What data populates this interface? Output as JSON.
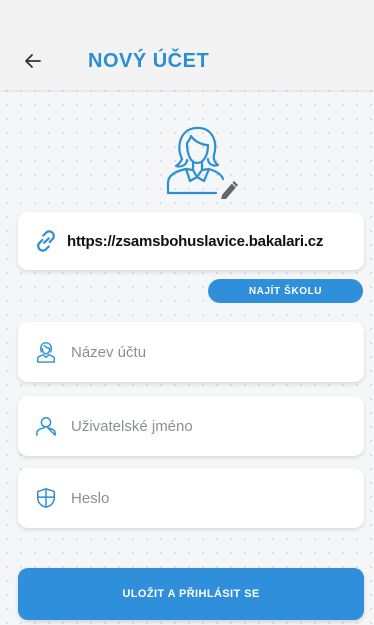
{
  "header": {
    "title": "NOVÝ ÚČET",
    "back_icon": "arrow-left-icon"
  },
  "avatar": {
    "icon": "user-avatar-icon",
    "edit_icon": "pencil-icon"
  },
  "school_url": {
    "value": "https://zsamsbohuslavice.bakalari.cz",
    "icon": "link-icon"
  },
  "find_school_label": "NAJÍT ŠKOLU",
  "account_name": {
    "placeholder": "Název účtu",
    "icon": "account-icon"
  },
  "username": {
    "placeholder": "Uživatelské jméno",
    "icon": "user-icon"
  },
  "password": {
    "placeholder": "Heslo",
    "icon": "shield-icon"
  },
  "save_label": "ULOŽIT A PŘIHLÁSIT SE",
  "colors": {
    "accent": "#2f8fdb",
    "title": "#2a8fd4",
    "background": "#f5f6f8"
  }
}
